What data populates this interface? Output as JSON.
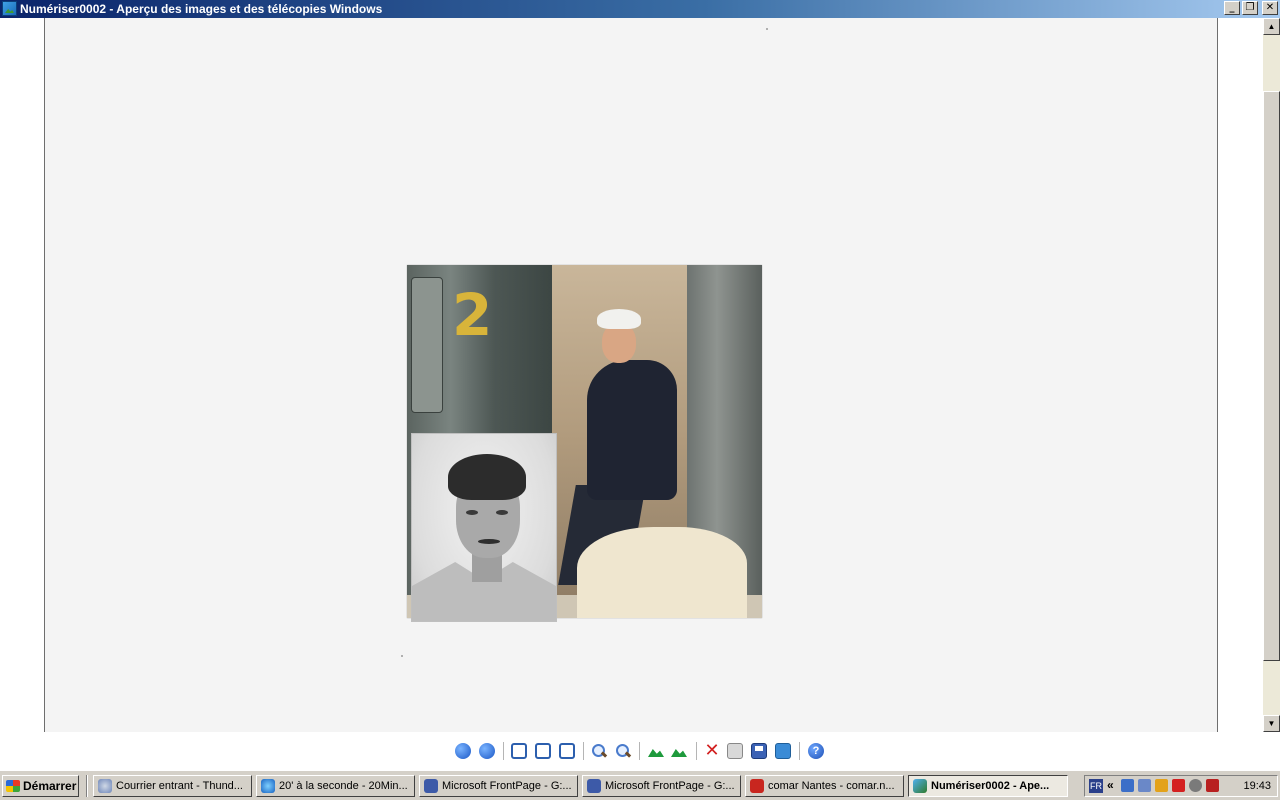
{
  "window": {
    "title": "Numériser0002 - Aperçu des images et des télécopies Windows",
    "buttons": {
      "minimize": "_",
      "restore": "❐",
      "close": "✕"
    }
  },
  "toolbar": {
    "buttons": [
      {
        "name": "previous-image",
        "icon": "arrow-left-circle-icon"
      },
      {
        "name": "next-image",
        "icon": "arrow-right-circle-icon"
      },
      {
        "name": "best-fit",
        "icon": "best-fit-icon"
      },
      {
        "name": "actual-size",
        "icon": "actual-size-icon"
      },
      {
        "name": "slideshow",
        "icon": "slideshow-icon"
      },
      {
        "name": "zoom-in",
        "icon": "zoom-in-icon"
      },
      {
        "name": "zoom-out",
        "icon": "zoom-out-icon"
      },
      {
        "name": "rotate-clockwise",
        "icon": "rotate-clockwise-icon"
      },
      {
        "name": "rotate-counterclockwise",
        "icon": "rotate-counterclockwise-icon"
      },
      {
        "name": "delete",
        "icon": "delete-icon"
      },
      {
        "name": "print",
        "icon": "print-icon"
      },
      {
        "name": "save",
        "icon": "save-icon"
      },
      {
        "name": "edit",
        "icon": "edit-icon"
      },
      {
        "name": "help",
        "icon": "help-icon"
      }
    ],
    "help_label": "?"
  },
  "taskbar": {
    "start_label": "Démarrer",
    "tasks": [
      {
        "label": "Courrier entrant - Thund...",
        "icon": "thunderbird-icon",
        "active": false
      },
      {
        "label": "20' à la seconde - 20Min...",
        "icon": "internet-explorer-icon",
        "active": false
      },
      {
        "label": "Microsoft FrontPage - G:...",
        "icon": "frontpage-icon",
        "active": false
      },
      {
        "label": "Microsoft FrontPage - G:...",
        "icon": "frontpage-icon",
        "active": false
      },
      {
        "label": "comar Nantes - comar.n...",
        "icon": "filezilla-icon",
        "active": false
      },
      {
        "label": "Numériser0002 - Ape...",
        "icon": "image-viewer-icon",
        "active": true
      }
    ],
    "tray": {
      "language": "FR",
      "expand": "«",
      "clock": "19:43"
    }
  },
  "image": {
    "sign_number": "2"
  }
}
